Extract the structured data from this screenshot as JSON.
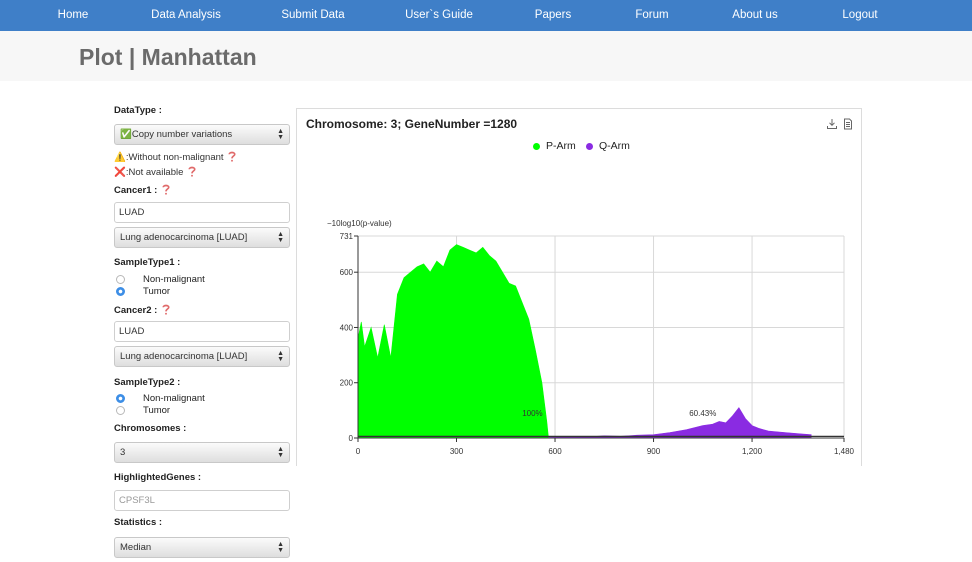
{
  "nav": {
    "items": [
      "Home",
      "Data Analysis",
      "Submit Data",
      "User`s Guide",
      "Papers",
      "Forum",
      "About us",
      "Logout"
    ]
  },
  "page": {
    "title": "Plot | Manhattan"
  },
  "sidebar": {
    "datatype_label": "DataType :",
    "datatype_value": "✅Copy number variations",
    "note_warning": "⚠️:Without non-malignant",
    "note_na": "❌:Not available",
    "cancer1_label": "Cancer1 :",
    "cancer1_input": "LUAD",
    "cancer1_select": "Lung adenocarcinoma [LUAD]",
    "sampletype1_label": "SampleType1 :",
    "sampletype1_options": [
      "Non-malignant",
      "Tumor"
    ],
    "sampletype1_selected": "Tumor",
    "cancer2_label": "Cancer2 :",
    "cancer2_input": "LUAD",
    "cancer2_select": "Lung adenocarcinoma [LUAD]",
    "sampletype2_label": "SampleType2 :",
    "sampletype2_options": [
      "Non-malignant",
      "Tumor"
    ],
    "sampletype2_selected": "Non-malignant",
    "chromosomes_label": "Chromosomes :",
    "chromosomes_value": "3",
    "highlighted_label": "HighlightedGenes :",
    "highlighted_placeholder": "CPSF3L",
    "statistics_label": "Statistics :",
    "statistics_value": "Median"
  },
  "chart": {
    "title": "Chromosome: 3; GeneNumber =1280",
    "tools": [
      "download-icon",
      "document-icon"
    ]
  },
  "colors": {
    "nav": "#3f7fc8",
    "p_arm": "#00ff00",
    "q_arm": "#8a2be2",
    "title": "#6b6b6b"
  },
  "chart_data": {
    "type": "area",
    "title": "Chromosome: 3; GeneNumber =1280",
    "ylabel": "−10log10(p-value)",
    "xlabel": "",
    "xlim": [
      0,
      1480
    ],
    "ylim": [
      0,
      731
    ],
    "xticks": [
      0,
      300,
      600,
      900,
      1200,
      1480
    ],
    "xtick_labels": [
      "0",
      "300",
      "600",
      "900",
      "1,200",
      "1,480"
    ],
    "yticks": [
      0,
      200,
      400,
      600,
      731
    ],
    "ytick_labels": [
      "0",
      "200",
      "400",
      "600",
      "731"
    ],
    "grid": true,
    "legend_position": "top-center",
    "series": [
      {
        "name": "P-Arm",
        "color": "#00ff00",
        "annotation": "100%",
        "x": [
          0,
          10,
          20,
          40,
          60,
          80,
          100,
          120,
          140,
          160,
          180,
          200,
          220,
          240,
          260,
          280,
          300,
          320,
          340,
          360,
          380,
          400,
          420,
          440,
          460,
          480,
          500,
          520,
          540,
          560,
          575,
          580
        ],
        "y": [
          360,
          420,
          330,
          400,
          290,
          410,
          290,
          520,
          580,
          600,
          620,
          630,
          600,
          640,
          620,
          680,
          700,
          690,
          680,
          670,
          690,
          660,
          640,
          600,
          560,
          550,
          490,
          430,
          320,
          200,
          60,
          0
        ]
      },
      {
        "name": "Q-Arm",
        "color": "#8a2be2",
        "annotation": "60.43%",
        "x": [
          580,
          700,
          750,
          800,
          850,
          900,
          950,
          1000,
          1050,
          1080,
          1100,
          1120,
          1140,
          1160,
          1180,
          1200,
          1220,
          1250,
          1300,
          1350,
          1380
        ],
        "y": [
          2,
          4,
          8,
          6,
          10,
          12,
          20,
          30,
          45,
          50,
          60,
          55,
          80,
          110,
          70,
          45,
          35,
          25,
          20,
          15,
          12
        ]
      }
    ]
  }
}
